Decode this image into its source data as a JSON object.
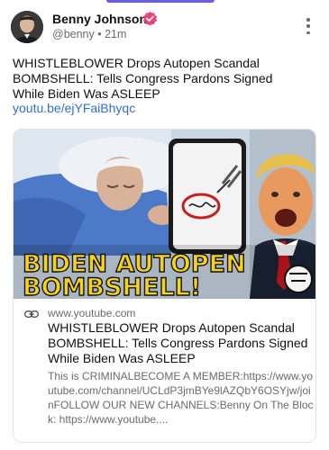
{
  "post": {
    "author": "Benny Johnson",
    "handle": "@benny",
    "separator": "•",
    "time": "21m",
    "text": "WHISTLEBLOWER Drops Autopen Scandal BOMBSHELL: Tells Congress Pardons Signed While Biden Was ASLEEP",
    "link": "youtu.be/ejYFaiBhyqc",
    "verified_color": "#e8457a"
  },
  "card": {
    "thumbnail_line1": "BIDEN AUTOPEN",
    "thumbnail_line2": "BOMBSHELL!",
    "domain": "www.youtube.com",
    "title": "WHISTLEBLOWER Drops Autopen Scandal BOMBSHELL: Tells Congress Pardons Signed While Biden Was ASLEEP",
    "description": "This is CRIMINALBECOME A MEMBER:https://www.youtube.com/channel/UCLdP3jmBYe9lAZQbY6OSYjw/joinFOLLOW OUR NEW CHANNELS:Benny On The Block: https://www.youtube...."
  },
  "icons": {
    "more": "more-vertical-icon",
    "link": "link-icon",
    "verified": "verified-badge-icon"
  }
}
